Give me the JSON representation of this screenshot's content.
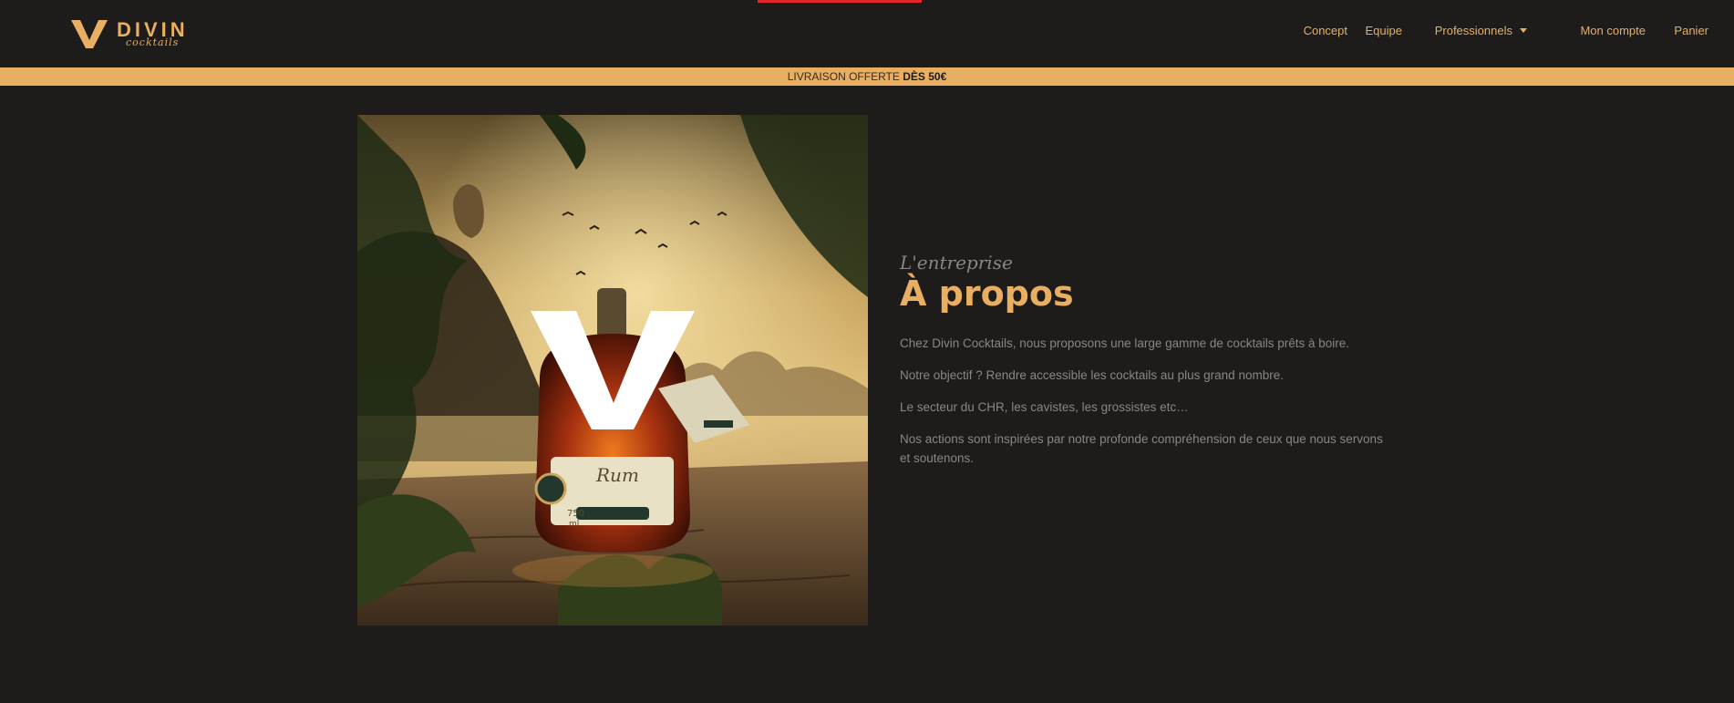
{
  "brand": {
    "name": "DIVIN",
    "tagline": "cocktails",
    "accent_color": "#e8ae62",
    "top_accent_color": "#e3262d"
  },
  "nav": {
    "items": [
      {
        "label": "Concept"
      },
      {
        "label": "Equipe"
      },
      {
        "label": "Professionnels",
        "has_dropdown": true
      },
      {
        "label": "Mon compte"
      },
      {
        "label": "Panier"
      }
    ]
  },
  "promo": {
    "text": "LIVRAISON OFFERTE",
    "highlight": "DÈS 50€"
  },
  "hero": {
    "bottle_label": "Rum",
    "volume": "750",
    "volume_unit": "ml"
  },
  "about": {
    "kicker": "L'entreprise",
    "title": "À propos",
    "paragraphs": [
      "Chez Divin Cocktails, nous proposons une large gamme de cocktails prêts à boire.",
      "Notre objectif ? Rendre accessible les cocktails au plus grand nombre.",
      "Le secteur du CHR, les cavistes, les grossistes etc…",
      "Nos actions sont inspirées par notre profonde compréhension de ceux que nous servons et soutenons."
    ]
  }
}
